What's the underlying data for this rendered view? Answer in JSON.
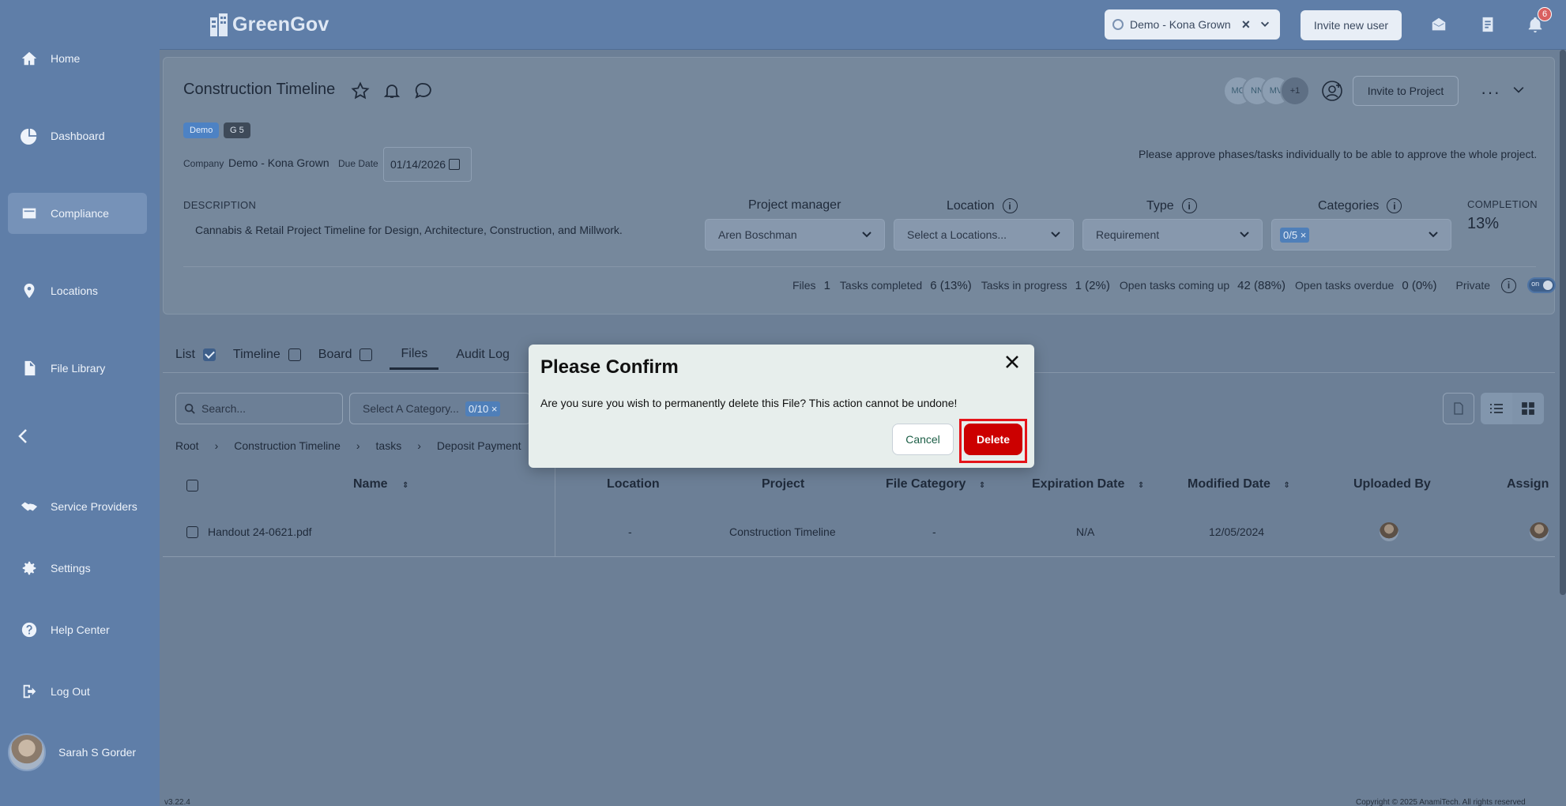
{
  "app": {
    "logo_text": "GreenGov"
  },
  "sidebar": {
    "items": [
      {
        "label": "Home",
        "icon": "home-icon"
      },
      {
        "label": "Dashboard",
        "icon": "pie-chart-icon"
      },
      {
        "label": "Compliance",
        "icon": "folder-icon",
        "active": true
      },
      {
        "label": "Locations",
        "icon": "map-pin-icon"
      },
      {
        "label": "File Library",
        "icon": "file-icon"
      },
      {
        "label": "Service Providers",
        "icon": "handshake-icon"
      },
      {
        "label": "Settings",
        "icon": "gear-icon"
      },
      {
        "label": "Help Center",
        "icon": "help-icon"
      },
      {
        "label": "Log Out",
        "icon": "logout-icon"
      }
    ],
    "user_name": "Sarah S Gorder"
  },
  "topbar": {
    "company": "Demo - Kona Grown",
    "invite_user": "Invite new user",
    "notification_count": "6"
  },
  "project": {
    "title": "Construction Timeline",
    "tags": [
      "Demo",
      "G 5"
    ],
    "company_label": "Company",
    "company_value": "Demo - Kona Grown",
    "due_label": "Due Date",
    "due_value": "01/14/2026",
    "approve_note": "Please approve phases/tasks individually to be able to approve the whole project.",
    "avatars": [
      "MC",
      "NN",
      "MV",
      "+1"
    ],
    "invite_label": "Invite to Project",
    "description_label": "DESCRIPTION",
    "description": "Cannabis & Retail Project Timeline for Design, Architecture, Construction, and Millwork.",
    "fields": {
      "manager_label": "Project manager",
      "manager_value": "Aren Boschman",
      "location_label": "Location",
      "location_value": "Select a Locations...",
      "type_label": "Type",
      "type_value": "Requirement",
      "categories_label": "Categories",
      "categories_value": "0/5"
    },
    "completion_label": "COMPLETION",
    "completion_value": "13%",
    "stats": {
      "files_label": "Files",
      "files_value": "1",
      "completed_label": "Tasks completed",
      "completed_value": "6 (13%)",
      "progress_label": "Tasks in progress",
      "progress_value": "1 (2%)",
      "upcoming_label": "Open tasks coming up",
      "upcoming_value": "42 (88%)",
      "overdue_label": "Open tasks overdue",
      "overdue_value": "0 (0%)",
      "private_label": "Private",
      "toggle_text": "on"
    }
  },
  "tabs": [
    {
      "label": "List",
      "checked": true
    },
    {
      "label": "Timeline",
      "checked": false
    },
    {
      "label": "Board",
      "checked": false
    },
    {
      "label": "Files"
    },
    {
      "label": "Audit Log"
    }
  ],
  "files": {
    "search_placeholder": "Search...",
    "category_placeholder": "Select A Category...",
    "category_count": "0/10",
    "breadcrumb": [
      "Root",
      "Construction Timeline",
      "tasks",
      "Deposit Payment"
    ],
    "columns": [
      "Name",
      "Location",
      "Project",
      "File Category",
      "Expiration Date",
      "Modified Date",
      "Uploaded By",
      "Assign"
    ],
    "rows": [
      {
        "name": "Handout 24-0621.pdf",
        "location": "-",
        "project": "Construction Timeline",
        "category": "-",
        "expiration": "N/A",
        "modified": "12/05/2024"
      }
    ]
  },
  "footer": {
    "version": "v3.22.4",
    "copyright": "Copyright © 2025 AnamiTech. All rights reserved"
  },
  "modal": {
    "title": "Please Confirm",
    "message": "Are you sure you wish to permanently delete this File? This action cannot be undone!",
    "cancel": "Cancel",
    "delete": "Delete"
  },
  "colors": {
    "sidebar": "#5f7ea8",
    "delete": "#cc0000",
    "highlight": "#e5141a"
  }
}
